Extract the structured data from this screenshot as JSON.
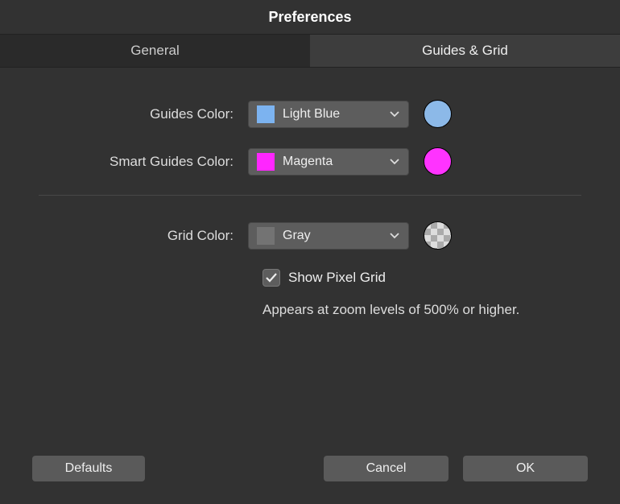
{
  "title": "Preferences",
  "tabs": {
    "general": "General",
    "guides": "Guides & Grid"
  },
  "labels": {
    "guidesColor": "Guides Color:",
    "smartGuidesColor": "Smart Guides Color:",
    "gridColor": "Grid Color:"
  },
  "selects": {
    "guidesColor": {
      "value": "Light Blue",
      "swatch": "#7cb3f0"
    },
    "smartGuidesColor": {
      "value": "Magenta",
      "swatch": "#ff26ff"
    },
    "gridColor": {
      "value": "Gray",
      "swatch": "#737373"
    }
  },
  "circles": {
    "guides": "#8cb9e8",
    "smart": "#ff33ff"
  },
  "checkbox": {
    "label": "Show Pixel Grid",
    "checked": true
  },
  "hint": "Appears at zoom levels of 500% or higher.",
  "buttons": {
    "defaults": "Defaults",
    "cancel": "Cancel",
    "ok": "OK"
  }
}
